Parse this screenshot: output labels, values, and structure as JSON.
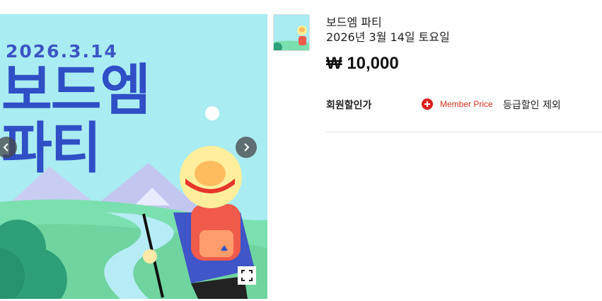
{
  "gallery": {
    "poster_date": "2026.3.14",
    "poster_title_line1": "보드엠",
    "poster_title_line2": "파티",
    "thumb_title": "보드엠 파티"
  },
  "product": {
    "name": "보드엠 파티",
    "subtitle": "2026년 3월 14일 토요일",
    "price": "₩ 10,000"
  },
  "member": {
    "label": "회원할인가",
    "price_label": "Member Price",
    "note": "등급할인 제외"
  },
  "icons": {
    "prev": "chevron-left-icon",
    "next": "chevron-right-icon",
    "expand": "expand-icon",
    "member": "plus-circle-icon"
  },
  "colors": {
    "title_blue": "#2f4fc6",
    "sky": "#a9ecf2",
    "member_red": "#e02020"
  }
}
